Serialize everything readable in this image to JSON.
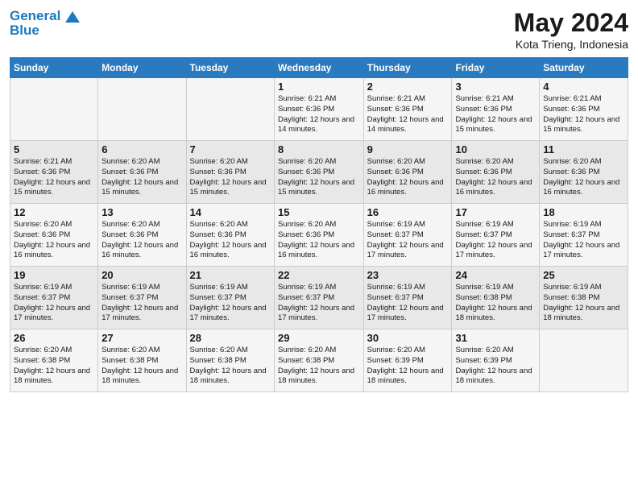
{
  "header": {
    "logo_line1": "General",
    "logo_line2": "Blue",
    "title": "May 2024",
    "subtitle": "Kota Trieng, Indonesia"
  },
  "weekdays": [
    "Sunday",
    "Monday",
    "Tuesday",
    "Wednesday",
    "Thursday",
    "Friday",
    "Saturday"
  ],
  "weeks": [
    [
      {
        "day": "",
        "info": ""
      },
      {
        "day": "",
        "info": ""
      },
      {
        "day": "",
        "info": ""
      },
      {
        "day": "1",
        "info": "Sunrise: 6:21 AM\nSunset: 6:36 PM\nDaylight: 12 hours\nand 14 minutes."
      },
      {
        "day": "2",
        "info": "Sunrise: 6:21 AM\nSunset: 6:36 PM\nDaylight: 12 hours\nand 14 minutes."
      },
      {
        "day": "3",
        "info": "Sunrise: 6:21 AM\nSunset: 6:36 PM\nDaylight: 12 hours\nand 15 minutes."
      },
      {
        "day": "4",
        "info": "Sunrise: 6:21 AM\nSunset: 6:36 PM\nDaylight: 12 hours\nand 15 minutes."
      }
    ],
    [
      {
        "day": "5",
        "info": "Sunrise: 6:21 AM\nSunset: 6:36 PM\nDaylight: 12 hours\nand 15 minutes."
      },
      {
        "day": "6",
        "info": "Sunrise: 6:20 AM\nSunset: 6:36 PM\nDaylight: 12 hours\nand 15 minutes."
      },
      {
        "day": "7",
        "info": "Sunrise: 6:20 AM\nSunset: 6:36 PM\nDaylight: 12 hours\nand 15 minutes."
      },
      {
        "day": "8",
        "info": "Sunrise: 6:20 AM\nSunset: 6:36 PM\nDaylight: 12 hours\nand 15 minutes."
      },
      {
        "day": "9",
        "info": "Sunrise: 6:20 AM\nSunset: 6:36 PM\nDaylight: 12 hours\nand 16 minutes."
      },
      {
        "day": "10",
        "info": "Sunrise: 6:20 AM\nSunset: 6:36 PM\nDaylight: 12 hours\nand 16 minutes."
      },
      {
        "day": "11",
        "info": "Sunrise: 6:20 AM\nSunset: 6:36 PM\nDaylight: 12 hours\nand 16 minutes."
      }
    ],
    [
      {
        "day": "12",
        "info": "Sunrise: 6:20 AM\nSunset: 6:36 PM\nDaylight: 12 hours\nand 16 minutes."
      },
      {
        "day": "13",
        "info": "Sunrise: 6:20 AM\nSunset: 6:36 PM\nDaylight: 12 hours\nand 16 minutes."
      },
      {
        "day": "14",
        "info": "Sunrise: 6:20 AM\nSunset: 6:36 PM\nDaylight: 12 hours\nand 16 minutes."
      },
      {
        "day": "15",
        "info": "Sunrise: 6:20 AM\nSunset: 6:36 PM\nDaylight: 12 hours\nand 16 minutes."
      },
      {
        "day": "16",
        "info": "Sunrise: 6:19 AM\nSunset: 6:37 PM\nDaylight: 12 hours\nand 17 minutes."
      },
      {
        "day": "17",
        "info": "Sunrise: 6:19 AM\nSunset: 6:37 PM\nDaylight: 12 hours\nand 17 minutes."
      },
      {
        "day": "18",
        "info": "Sunrise: 6:19 AM\nSunset: 6:37 PM\nDaylight: 12 hours\nand 17 minutes."
      }
    ],
    [
      {
        "day": "19",
        "info": "Sunrise: 6:19 AM\nSunset: 6:37 PM\nDaylight: 12 hours\nand 17 minutes."
      },
      {
        "day": "20",
        "info": "Sunrise: 6:19 AM\nSunset: 6:37 PM\nDaylight: 12 hours\nand 17 minutes."
      },
      {
        "day": "21",
        "info": "Sunrise: 6:19 AM\nSunset: 6:37 PM\nDaylight: 12 hours\nand 17 minutes."
      },
      {
        "day": "22",
        "info": "Sunrise: 6:19 AM\nSunset: 6:37 PM\nDaylight: 12 hours\nand 17 minutes."
      },
      {
        "day": "23",
        "info": "Sunrise: 6:19 AM\nSunset: 6:37 PM\nDaylight: 12 hours\nand 17 minutes."
      },
      {
        "day": "24",
        "info": "Sunrise: 6:19 AM\nSunset: 6:38 PM\nDaylight: 12 hours\nand 18 minutes."
      },
      {
        "day": "25",
        "info": "Sunrise: 6:19 AM\nSunset: 6:38 PM\nDaylight: 12 hours\nand 18 minutes."
      }
    ],
    [
      {
        "day": "26",
        "info": "Sunrise: 6:20 AM\nSunset: 6:38 PM\nDaylight: 12 hours\nand 18 minutes."
      },
      {
        "day": "27",
        "info": "Sunrise: 6:20 AM\nSunset: 6:38 PM\nDaylight: 12 hours\nand 18 minutes."
      },
      {
        "day": "28",
        "info": "Sunrise: 6:20 AM\nSunset: 6:38 PM\nDaylight: 12 hours\nand 18 minutes."
      },
      {
        "day": "29",
        "info": "Sunrise: 6:20 AM\nSunset: 6:38 PM\nDaylight: 12 hours\nand 18 minutes."
      },
      {
        "day": "30",
        "info": "Sunrise: 6:20 AM\nSunset: 6:39 PM\nDaylight: 12 hours\nand 18 minutes."
      },
      {
        "day": "31",
        "info": "Sunrise: 6:20 AM\nSunset: 6:39 PM\nDaylight: 12 hours\nand 18 minutes."
      },
      {
        "day": "",
        "info": ""
      }
    ]
  ]
}
